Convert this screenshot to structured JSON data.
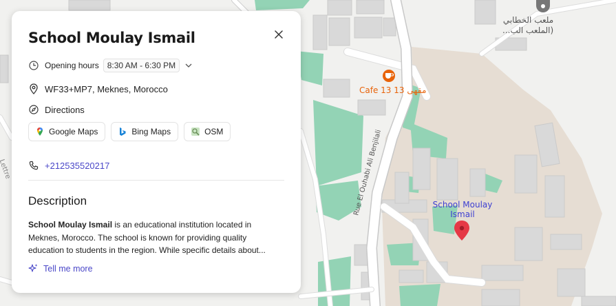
{
  "place": {
    "name": "School Moulay Ismail",
    "hours_label": "Opening hours",
    "hours_value": "8:30 AM - 6:30 PM",
    "address": "WF33+MP7, Meknes, Morocco",
    "directions_label": "Directions",
    "map_buttons": [
      {
        "label": "Google Maps",
        "icon": "google-maps-icon"
      },
      {
        "label": "Bing Maps",
        "icon": "bing-icon"
      },
      {
        "label": "OSM",
        "icon": "osm-icon"
      }
    ],
    "phone": "+212535520217",
    "description_title": "Description",
    "description_bold": "School Moulay Ismail",
    "description_lines": [
      " is an educational institution located in",
      "Meknes, Morocco. The school is known for providing quality",
      "education to students in the region. While specific details about..."
    ],
    "tell_more": "Tell me more"
  },
  "map": {
    "labels": {
      "school_line1": "School Moulay",
      "school_line2": "Ismail",
      "cafe": "Cafe 13 مقهى 13",
      "street": "Rue El Ouhabi Ali Benjilali",
      "stadium_line1": "ملعب الخطابي",
      "stadium_line2": "(الملعب الب...",
      "left_road": "Lettre"
    },
    "colors": {
      "school_label": "#3d3fd1",
      "cafe": "#e8630a",
      "pin": "#e53946",
      "green": "#93d3b5",
      "campus": "#e6ddd2",
      "building": "#d6d6d6"
    },
    "icons": [
      "cafe-icon",
      "map-pin-icon",
      "stadium-icon"
    ]
  }
}
